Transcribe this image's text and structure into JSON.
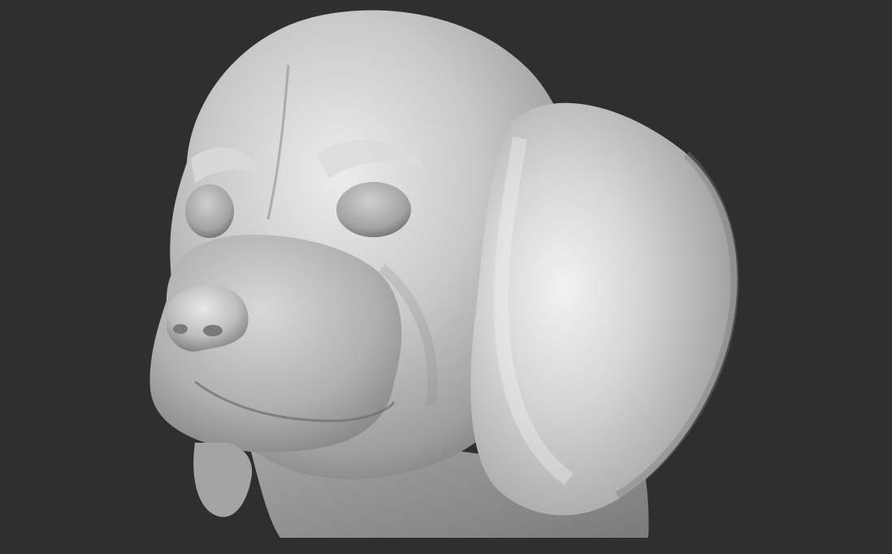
{
  "viewport": {
    "background": "#2f2f2f",
    "material_base": "#bfbfbf",
    "material_highlight": "#ececec",
    "material_shadow": "#6f6f6f"
  },
  "model": {
    "subject": "dog-head-sculpt"
  }
}
